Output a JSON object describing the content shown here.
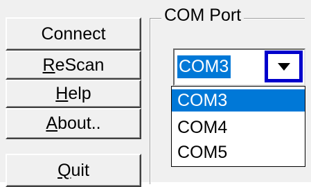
{
  "buttons": {
    "connect": {
      "label": "Connect"
    },
    "rescan": {
      "mnemonic": "R",
      "rest": "eScan"
    },
    "help": {
      "mnemonic": "H",
      "rest": "elp"
    },
    "about": {
      "mnemonic": "A",
      "rest": "bout.."
    },
    "quit": {
      "mnemonic": "Q",
      "rest": "uit"
    }
  },
  "com_port": {
    "title": "COM Port",
    "selected_value": "COM3",
    "options": [
      "COM3",
      "COM4",
      "COM5"
    ],
    "highlighted_index": 0
  },
  "icons": {
    "dropdown_arrow": "chevron-down-icon"
  },
  "colors": {
    "selection": "#0078d7",
    "focus_border": "#0000cc",
    "panel": "#f0f0f0"
  }
}
